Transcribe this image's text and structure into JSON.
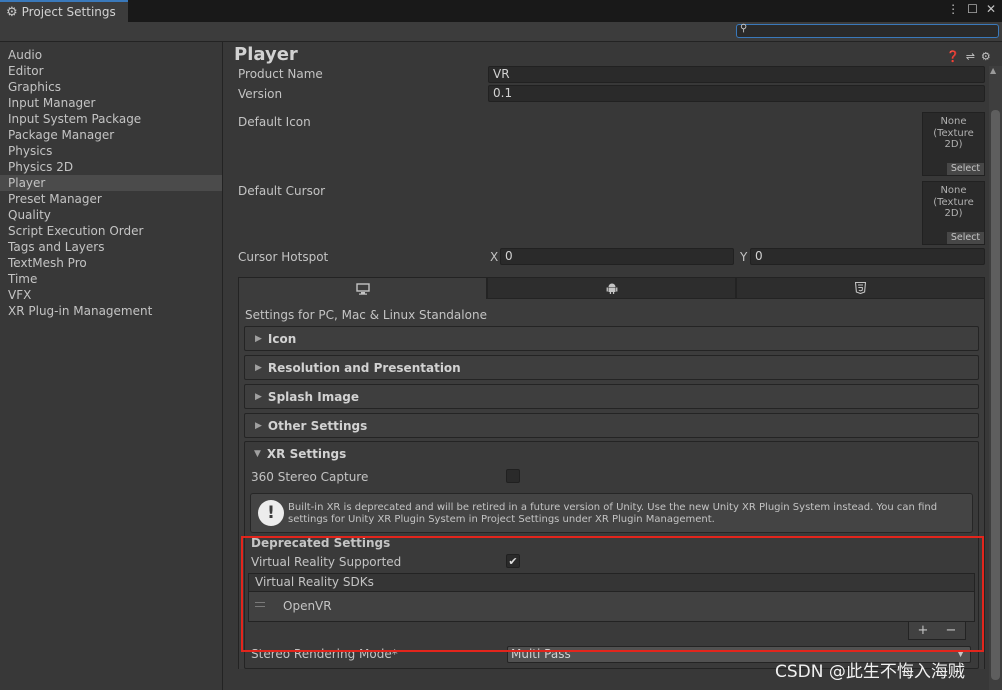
{
  "window": {
    "tab_title": "Project Settings",
    "tab_icon": "gear-icon",
    "menu_icon": "kebab-menu-icon",
    "maximize_icon": "maximize-icon",
    "close_icon": "close-icon"
  },
  "search": {
    "placeholder": "",
    "value": ""
  },
  "sidebar": {
    "items": [
      {
        "label": "Audio"
      },
      {
        "label": "Editor"
      },
      {
        "label": "Graphics"
      },
      {
        "label": "Input Manager"
      },
      {
        "label": "Input System Package"
      },
      {
        "label": "Package Manager"
      },
      {
        "label": "Physics"
      },
      {
        "label": "Physics 2D"
      },
      {
        "label": "Player",
        "selected": true
      },
      {
        "label": "Preset Manager"
      },
      {
        "label": "Quality"
      },
      {
        "label": "Script Execution Order"
      },
      {
        "label": "Tags and Layers"
      },
      {
        "label": "TextMesh Pro"
      },
      {
        "label": "Time"
      },
      {
        "label": "VFX"
      },
      {
        "label": "XR Plug-in Management"
      }
    ]
  },
  "player": {
    "title": "Player",
    "product_name_label": "Product Name",
    "product_name_value": "VR",
    "version_label": "Version",
    "version_value": "0.1",
    "default_icon_label": "Default Icon",
    "default_cursor_label": "Default Cursor",
    "texture_none": "None",
    "texture_type": "(Texture 2D)",
    "select_label": "Select",
    "cursor_hotspot_label": "Cursor Hotspot",
    "hotspot_x_label": "X",
    "hotspot_x_value": "0",
    "hotspot_y_label": "Y",
    "hotspot_y_value": "0"
  },
  "platforms": {
    "tabs": [
      {
        "icon": "desktop-icon",
        "active": true
      },
      {
        "icon": "android-icon",
        "active": false
      },
      {
        "icon": "html5-icon",
        "active": false
      }
    ],
    "settings_for": "Settings for PC, Mac & Linux Standalone"
  },
  "sections": {
    "icon": "Icon",
    "resolution": "Resolution and Presentation",
    "splash": "Splash Image",
    "other": "Other Settings",
    "xr": "XR Settings"
  },
  "xr": {
    "stereo_capture_label": "360 Stereo Capture",
    "stereo_capture_checked": false,
    "help_text": "Built-in XR is deprecated and will be retired in a future version of Unity. Use the new Unity XR Plugin System instead. You can find settings for Unity XR Plugin System in Project Settings under XR Plugin Management.",
    "deprecated_header": "Deprecated Settings",
    "vr_supported_label": "Virtual Reality Supported",
    "vr_supported_checked": true,
    "vr_sdks_label": "Virtual Reality SDKs",
    "sdk_items": [
      "OpenVR"
    ],
    "add_label": "+",
    "remove_label": "−",
    "stereo_mode_label": "Stereo Rendering Mode*",
    "stereo_mode_value": "Multi Pass"
  },
  "colors": {
    "highlight": "#e3251c",
    "accent": "#3a79bb"
  },
  "watermark": "CSDN @此生不悔入海贼"
}
